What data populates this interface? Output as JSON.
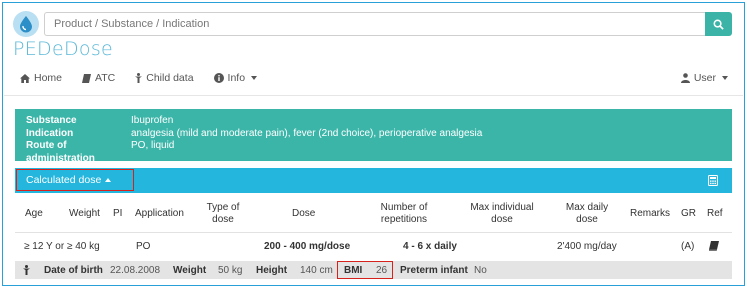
{
  "search": {
    "placeholder": "Product / Substance / Indication"
  },
  "brand": {
    "name": "PEDeDose"
  },
  "nav": {
    "home": "Home",
    "atc": "ATC",
    "child_data": "Child data",
    "info": "Info",
    "user": "User"
  },
  "substance": {
    "substance_label": "Substance",
    "substance_value": "Ibuprofen",
    "indication_label": "Indication",
    "indication_value": "analgesia (mild and moderate pain), fever (2nd choice), perioperative analgesia",
    "route_label": "Route of administration",
    "route_value": "PO, liquid"
  },
  "dose": {
    "toggle_label": "Calculated dose"
  },
  "table": {
    "headers": {
      "age": "Age",
      "weight": "Weight",
      "pi": "PI",
      "application": "Application",
      "type_of_dose_1": "Type of",
      "type_of_dose_2": "dose",
      "dose": "Dose",
      "repetitions_1": "Number of",
      "repetitions_2": "repetitions",
      "max_individual_1": "Max individual",
      "max_individual_2": "dose",
      "max_daily_1": "Max daily",
      "max_daily_2": "dose",
      "remarks": "Remarks",
      "gr": "GR",
      "ref": "Ref"
    },
    "row": {
      "age_weight": "≥ 12 Y or ≥ 40 kg",
      "application": "PO",
      "dose": "200 - 400 mg/dose",
      "repetitions": "4 - 6 x daily",
      "max_daily": "2'400 mg/day",
      "gr": "(A)"
    }
  },
  "patient": {
    "dob_label": "Date of birth",
    "dob_value": "22.08.2008",
    "weight_label": "Weight",
    "weight_value": "50 kg",
    "height_label": "Height",
    "height_value": "140 cm",
    "bmi_label": "BMI",
    "bmi_value": "26",
    "preterm_label": "Preterm infant",
    "preterm_value": "No"
  },
  "colors": {
    "accent_teal": "#3cb5a9",
    "accent_blue": "#25b6dd",
    "highlight_red": "#d6221d",
    "frame_blue": "#2aa0d8"
  },
  "icons": [
    "drop-logo-icon",
    "search-icon",
    "home-icon",
    "book-icon",
    "child-icon",
    "info-icon",
    "user-icon",
    "calculator-icon",
    "reference-book-icon"
  ]
}
